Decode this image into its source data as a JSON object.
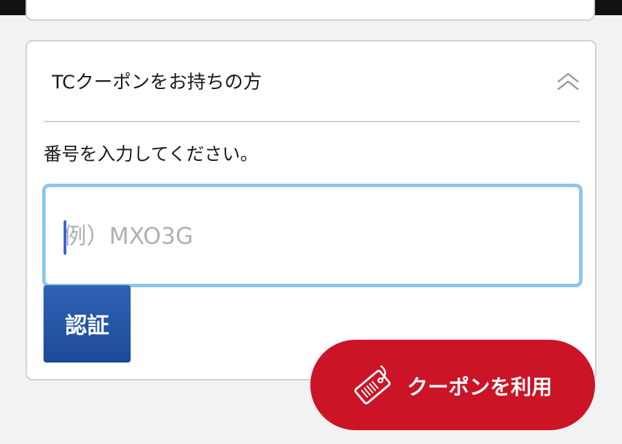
{
  "coupon_section": {
    "title": "TCクーポンをお持ちの方",
    "prompt": "番号を入力してください。",
    "input": {
      "value": "",
      "placeholder": "例）MXO3G"
    },
    "auth_button_label": "認証"
  },
  "floating_button": {
    "label": "クーポンを利用",
    "icon": "coupon-tag-icon"
  },
  "colors": {
    "auth_button": "#1c4a98",
    "floating_button": "#cc1427",
    "input_focus_border": "#8cc4f0",
    "background": "#f2f2f2"
  }
}
